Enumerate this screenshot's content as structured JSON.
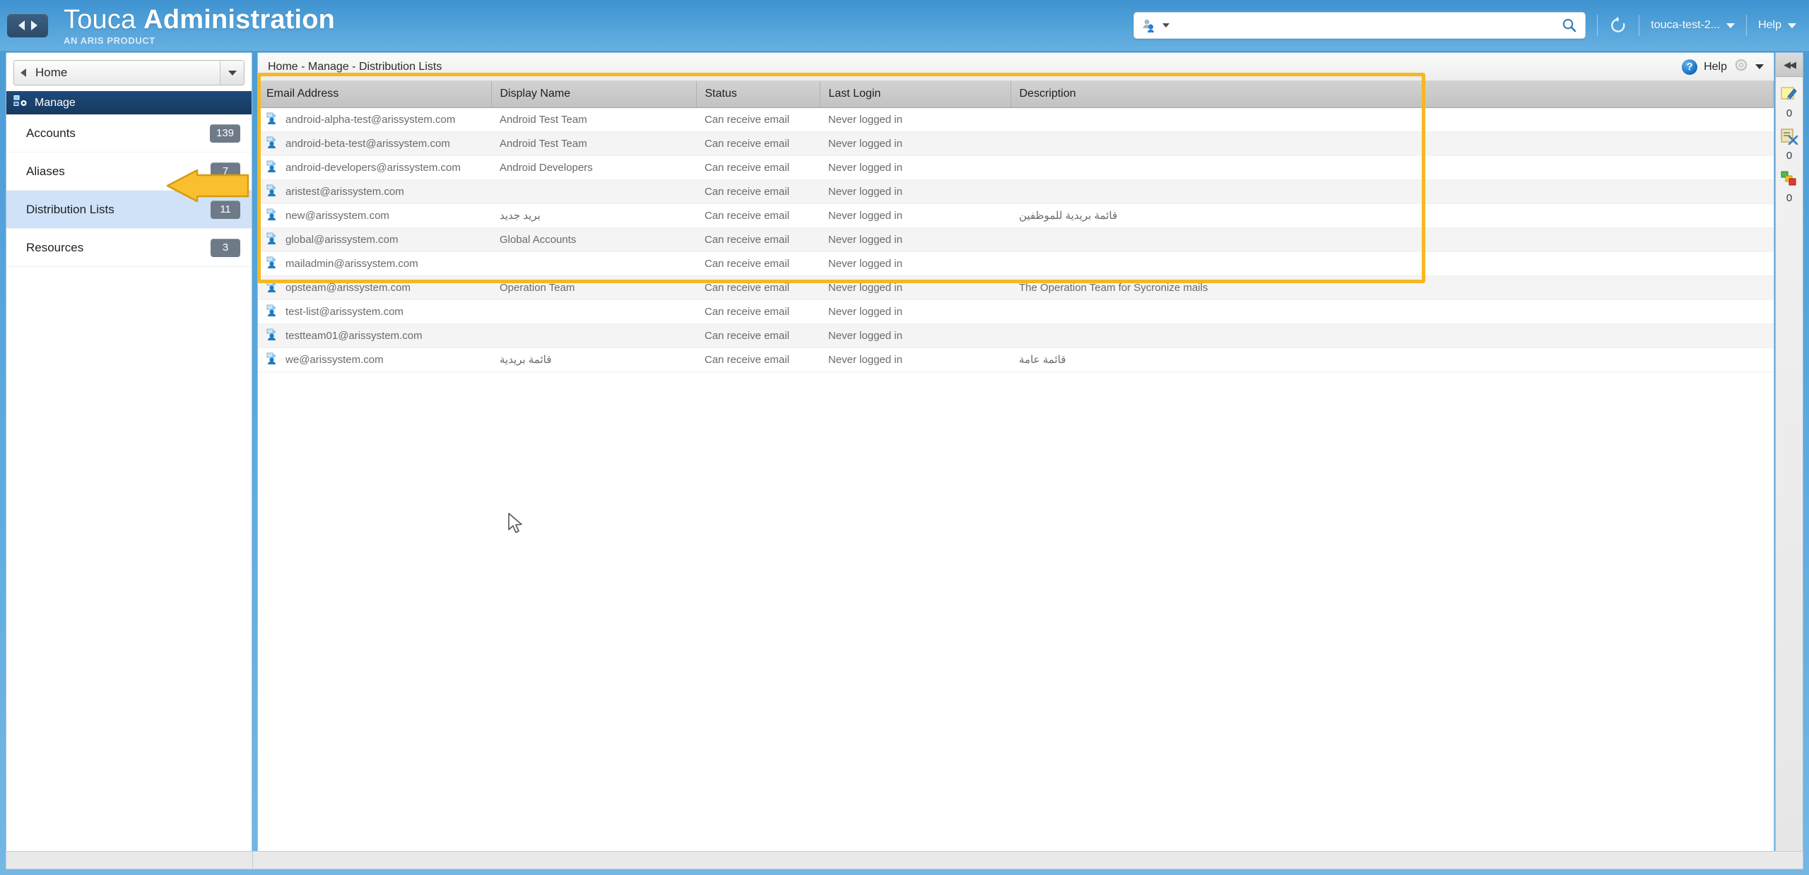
{
  "header": {
    "nav_back_icon": "triangle-left-icon",
    "nav_forward_icon": "triangle-right-icon",
    "title_main": "Touca",
    "title_accent": "Administration",
    "subtitle": "AN ARIS PRODUCT",
    "search": {
      "value": "",
      "placeholder": "",
      "scope_icon": "search-scope-icon",
      "go_icon": "magnifier-icon"
    },
    "refresh_icon": "refresh-icon",
    "user_menu": "touca-test-2...",
    "help_menu": "Help"
  },
  "sidebar": {
    "selector": {
      "label": "Home",
      "back_icon": "chevron-left-icon",
      "caret_icon": "chevron-down-icon"
    },
    "section": {
      "label": "Manage",
      "icon": "manage-gear-icon"
    },
    "items": [
      {
        "label": "Accounts",
        "badge": "139",
        "selected": false
      },
      {
        "label": "Aliases",
        "badge": "7",
        "selected": false
      },
      {
        "label": "Distribution Lists",
        "badge": "11",
        "selected": true
      },
      {
        "label": "Resources",
        "badge": "3",
        "selected": false
      }
    ]
  },
  "content": {
    "breadcrumb": "Home - Manage - Distribution Lists",
    "help_icon": "help-question-icon",
    "help_label": "Help",
    "gear_icon": "gear-icon",
    "caret_icon": "chevron-down-icon",
    "columns": [
      "Email Address",
      "Display Name",
      "Status",
      "Last Login",
      "Description"
    ],
    "rows": [
      {
        "email": "android-alpha-test@arissystem.com",
        "display_name": "Android Test Team",
        "status": "Can receive email",
        "last_login": "Never logged in",
        "description": ""
      },
      {
        "email": "android-beta-test@arissystem.com",
        "display_name": "Android Test Team",
        "status": "Can receive email",
        "last_login": "Never logged in",
        "description": ""
      },
      {
        "email": "android-developers@arissystem.com",
        "display_name": "Android Developers",
        "status": "Can receive email",
        "last_login": "Never logged in",
        "description": ""
      },
      {
        "email": "aristest@arissystem.com",
        "display_name": "",
        "status": "Can receive email",
        "last_login": "Never logged in",
        "description": ""
      },
      {
        "email": "new@arissystem.com",
        "display_name": "بريد جديد",
        "status": "Can receive email",
        "last_login": "Never logged in",
        "description": "قائمة بريدية للموظفين"
      },
      {
        "email": "global@arissystem.com",
        "display_name": "Global Accounts",
        "status": "Can receive email",
        "last_login": "Never logged in",
        "description": ""
      },
      {
        "email": "mailadmin@arissystem.com",
        "display_name": "",
        "status": "Can receive email",
        "last_login": "Never logged in",
        "description": ""
      },
      {
        "email": "opsteam@arissystem.com",
        "display_name": "Operation Team",
        "status": "Can receive email",
        "last_login": "Never logged in",
        "description": "The Operation Team for Sycronize mails"
      },
      {
        "email": "test-list@arissystem.com",
        "display_name": "",
        "status": "Can receive email",
        "last_login": "Never logged in",
        "description": ""
      },
      {
        "email": "testteam01@arissystem.com",
        "display_name": "",
        "status": "Can receive email",
        "last_login": "Never logged in",
        "description": ""
      },
      {
        "email": "we@arissystem.com",
        "display_name": "قائمة بريدية",
        "status": "Can receive email",
        "last_login": "Never logged in",
        "description": "قائمة عامة"
      }
    ],
    "row_icon": "distribution-list-icon"
  },
  "rail": {
    "collapse_icon": "collapse-right-icon",
    "groups": [
      {
        "icon": "notes-pencil-icon",
        "count": "0"
      },
      {
        "icon": "tasks-clipboard-icon",
        "count": "0"
      },
      {
        "icon": "alerts-blocks-icon",
        "count": "0"
      }
    ]
  },
  "annotations": {
    "arrow_color": "#f5b820",
    "highlight_color": "#f5b820"
  }
}
